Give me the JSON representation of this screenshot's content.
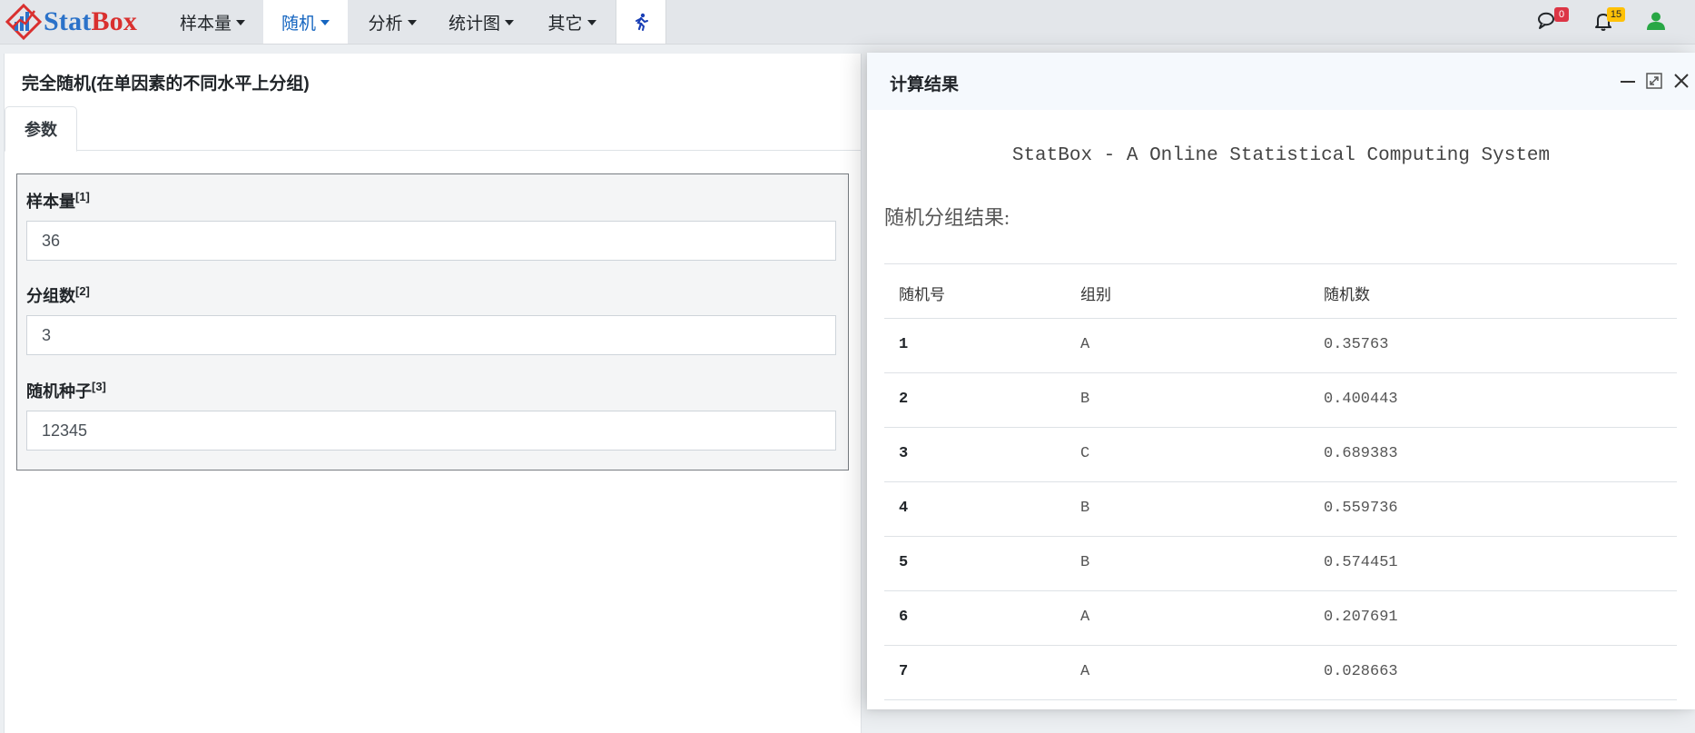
{
  "navbar": {
    "brand": {
      "part1": "Stat",
      "part2": "Box"
    },
    "items": [
      {
        "label": "样本量"
      },
      {
        "label": "随机"
      },
      {
        "label": "分析"
      },
      {
        "label": "统计图"
      },
      {
        "label": "其它"
      }
    ],
    "active_index": 1,
    "messages_badge": "0",
    "notifications_badge": "15",
    "icons": [
      "brand-logo-icon",
      "running-person-icon",
      "chat-icon",
      "bell-icon",
      "user-icon"
    ],
    "colors": {
      "active": "#1565c0",
      "brand_red": "#d9302f",
      "brand_blue": "#2b72c9",
      "badge_red": "#dc3545",
      "badge_yellow": "#ffc107",
      "user": "#28a745"
    }
  },
  "left_panel": {
    "title": "完全随机(在单因素的不同水平上分组)",
    "tab": "参数",
    "fields": [
      {
        "label": "样本量",
        "ref": "[1]",
        "value": "36"
      },
      {
        "label": "分组数",
        "ref": "[2]",
        "value": "3"
      },
      {
        "label": "随机种子",
        "ref": "[3]",
        "value": "12345"
      }
    ]
  },
  "result_panel": {
    "title": "计算结果",
    "system_title": "StatBox - A Online Statistical Computing System",
    "section_label": "随机分组结果:",
    "table": {
      "headers": [
        "随机号",
        "组别",
        "随机数"
      ],
      "rows": [
        [
          "1",
          "A",
          "0.35763"
        ],
        [
          "2",
          "B",
          "0.400443"
        ],
        [
          "3",
          "C",
          "0.689383"
        ],
        [
          "4",
          "B",
          "0.559736"
        ],
        [
          "5",
          "B",
          "0.574451"
        ],
        [
          "6",
          "A",
          "0.207691"
        ],
        [
          "7",
          "A",
          "0.028663"
        ]
      ]
    },
    "window_buttons": [
      "minimize-icon",
      "maximize-icon",
      "close-icon"
    ]
  }
}
